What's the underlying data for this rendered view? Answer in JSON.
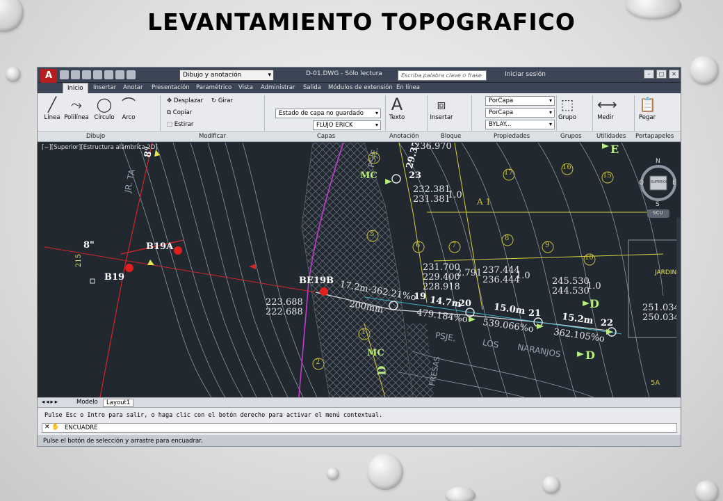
{
  "slide": {
    "title": "LEVANTAMIENTO TOPOGRAFICO"
  },
  "window": {
    "logo": "A",
    "workspace": "Dibujo y anotación",
    "document_title": "D-01.DWG - Sólo lectura",
    "search_placeholder": "Escriba palabra clave o frase",
    "login": "Iniciar sesión"
  },
  "tabs": [
    "Inicio",
    "Insertar",
    "Anotar",
    "Presentación",
    "Paramétrico",
    "Vista",
    "Administrar",
    "Salida",
    "Módulos de extensión",
    "En línea"
  ],
  "ribbon": {
    "dibujo": {
      "linea": "Línea",
      "polilinea": "Polilínea",
      "circulo": "Círculo",
      "arco": "Arco"
    },
    "modificar": {
      "desplazar": "Desplazar",
      "girar": "Girar",
      "copiar": "Copiar",
      "estirar": "Estirar"
    },
    "capas": {
      "estado": "Estado de capa no guardado",
      "layer": "FLUJO ERICK"
    },
    "anotacion": {
      "texto": "Texto"
    },
    "bloque": {
      "insertar": "Insertar"
    },
    "propiedades": {
      "color": "PorCapa",
      "linetype": "PorCapa",
      "lineweight": "BYLAY..."
    },
    "grupos": {
      "grupo": "Grupo"
    },
    "utilidades": {
      "medir": "Medir"
    },
    "portapapeles": {
      "pegar": "Pegar"
    },
    "panels": [
      "Dibujo",
      "Modificar",
      "Capas",
      "Anotación",
      "Bloque",
      "Propiedades",
      "Grupos",
      "Utilidades",
      "Portapapeles"
    ]
  },
  "viewport": {
    "label": "[−][Superior][Estructura alámbrica 2D]",
    "labels": {
      "b19a": "B19A",
      "b19": "B19",
      "be19b": "BE19B",
      "seg1": "17.2m-362.21%o",
      "pipe": "200mm",
      "n19": "19",
      "n20": "20",
      "n21": "21",
      "n22": "22",
      "n23": "23",
      "l147": "14.7m",
      "l150": "15.0m",
      "l152": "15.2m",
      "s479": "479.184%o",
      "s539": "539.066%o",
      "s362": "362.105%o",
      "e223a": "223.688",
      "e223b": "222.688",
      "e231a": "231.700",
      "e231b": "229.400",
      "e231c": "228.918",
      "e2791": "2.791",
      "e237a": "237.444",
      "e237b": "236.444",
      "e10a": "1.0",
      "e245a": "245.530",
      "e245b": "244.530",
      "e10b": "1.0",
      "e251a": "251.034",
      "e251b": "250.034",
      "e232a": "232.381",
      "e232b": "231.381",
      "e10c": "1.0",
      "e2937": "29.37",
      "e236": "236.970",
      "mc1": "MC",
      "mc2": "MC",
      "d1": "D",
      "d2": "D",
      "d3": "D",
      "e": "E",
      "a1": "A 1",
      "d8a": "8\"",
      "d8b": "8\"",
      "d215": "215",
      "street1": "JR. TA",
      "street2": "PSJE.",
      "street3": "PSJE.",
      "street4": "LOS",
      "street5": "NARANJOS",
      "fresas": "FRESAS",
      "jardin": "JARDIN",
      "fivea": "5A",
      "c5": "5",
      "c5b": "5",
      "c6": "6",
      "c7": "7",
      "c8": "8",
      "c9": "9",
      "c10": "10",
      "c15": "15",
      "c16": "16",
      "c17": "17",
      "c1": "1",
      "c2": "2",
      "c3": "3",
      "c4": "4",
      "compass_n": "N",
      "compass_s": "S",
      "compass_e": "E",
      "compass_o": "O",
      "compass_top": "SUPERIOR",
      "scu": "SCU"
    }
  },
  "layout_tabs": [
    "Modelo",
    "Layout1"
  ],
  "command": {
    "history": "Pulse Esc o Intro para salir, o haga clic con el botón derecho para activar el menú contextual.",
    "input": "ENCUADRE"
  },
  "status_text": "Pulse el botón de selección y arrastre para encuadrar.",
  "colors": {
    "accent": "#b51e1e",
    "viewport_bg": "#212830",
    "contour": "#9aa2ae",
    "pipe": "#d62626",
    "label_green": "#b9ec7e",
    "label_yellow": "#e9e54f",
    "magenta": "#c23ccf"
  }
}
